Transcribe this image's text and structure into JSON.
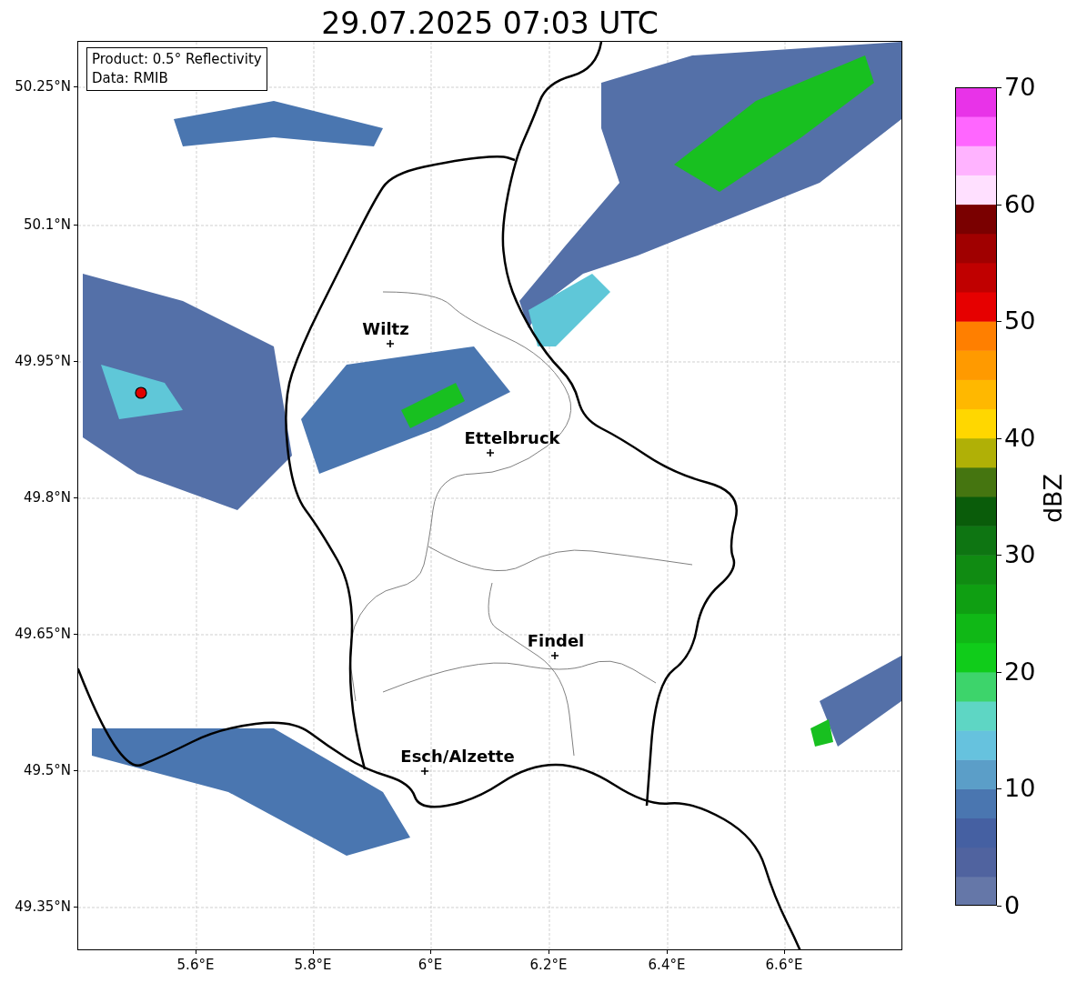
{
  "title": "29.07.2025 07:03 UTC",
  "info_box": {
    "lines": [
      "Product: 0.5° Reflectivity",
      "Data: RMIB"
    ]
  },
  "map": {
    "cities": [
      {
        "name": "Wiltz"
      },
      {
        "name": "Ettelbruck"
      },
      {
        "name": "Findel"
      },
      {
        "name": "Esch/Alzette"
      }
    ]
  },
  "x_ticks": [
    "5.6°E",
    "5.8°E",
    "6°E",
    "6.2°E",
    "6.4°E",
    "6.6°E"
  ],
  "y_ticks": [
    "50.25°N",
    "50.1°N",
    "49.95°N",
    "49.8°N",
    "49.65°N",
    "49.5°N",
    "49.35°N"
  ],
  "colorbar": {
    "label": "dBZ",
    "ticks": [
      "70",
      "60",
      "50",
      "40",
      "30",
      "20",
      "10",
      "0"
    ]
  }
}
